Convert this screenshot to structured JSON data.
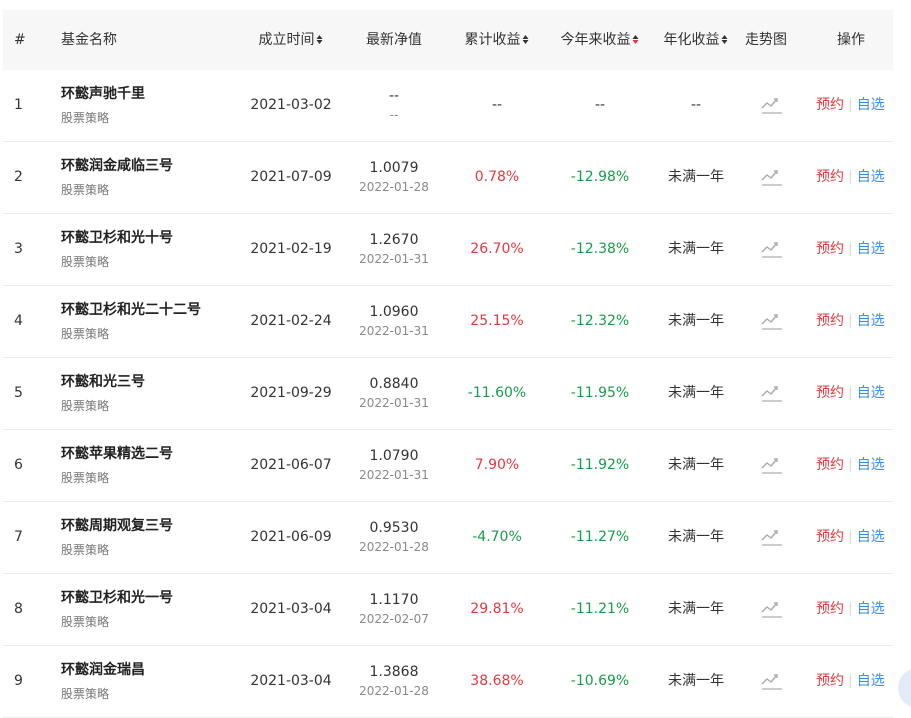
{
  "headers": {
    "index": "#",
    "name": "基金名称",
    "established": "成立时间",
    "nav": "最新净值",
    "cumulative": "累计收益",
    "ytd": "今年来收益",
    "annualized": "年化收益",
    "trend": "走势图",
    "actions": "操作"
  },
  "colors": {
    "positive": "#e0393e",
    "negative": "#1a9a4a",
    "link": "#3a8ee6",
    "header_bg": "#f7f7f7"
  },
  "action_labels": {
    "reserve": "预约",
    "watch": "自选"
  },
  "rows": [
    {
      "index": "1",
      "name": "环懿声驰千里",
      "category": "股票策略",
      "established": "2021-03-02",
      "nav": "--",
      "nav_date": "--",
      "cumulative": "--",
      "ytd": "--",
      "annualized": "--"
    },
    {
      "index": "2",
      "name": "环懿润金咸临三号",
      "category": "股票策略",
      "established": "2021-07-09",
      "nav": "1.0079",
      "nav_date": "2022-01-28",
      "cumulative": "0.78%",
      "ytd": "-12.98%",
      "annualized": "未满一年"
    },
    {
      "index": "3",
      "name": "环懿卫杉和光十号",
      "category": "股票策略",
      "established": "2021-02-19",
      "nav": "1.2670",
      "nav_date": "2022-01-31",
      "cumulative": "26.70%",
      "ytd": "-12.38%",
      "annualized": "未满一年"
    },
    {
      "index": "4",
      "name": "环懿卫杉和光二十二号",
      "category": "股票策略",
      "established": "2021-02-24",
      "nav": "1.0960",
      "nav_date": "2022-01-31",
      "cumulative": "25.15%",
      "ytd": "-12.32%",
      "annualized": "未满一年"
    },
    {
      "index": "5",
      "name": "环懿和光三号",
      "category": "股票策略",
      "established": "2021-09-29",
      "nav": "0.8840",
      "nav_date": "2022-01-31",
      "cumulative": "-11.60%",
      "ytd": "-11.95%",
      "annualized": "未满一年"
    },
    {
      "index": "6",
      "name": "环懿苹果精选二号",
      "category": "股票策略",
      "established": "2021-06-07",
      "nav": "1.0790",
      "nav_date": "2022-01-31",
      "cumulative": "7.90%",
      "ytd": "-11.92%",
      "annualized": "未满一年"
    },
    {
      "index": "7",
      "name": "环懿周期观复三号",
      "category": "股票策略",
      "established": "2021-06-09",
      "nav": "0.9530",
      "nav_date": "2022-01-28",
      "cumulative": "-4.70%",
      "ytd": "-11.27%",
      "annualized": "未满一年"
    },
    {
      "index": "8",
      "name": "环懿卫杉和光一号",
      "category": "股票策略",
      "established": "2021-03-04",
      "nav": "1.1170",
      "nav_date": "2022-02-07",
      "cumulative": "29.81%",
      "ytd": "-11.21%",
      "annualized": "未满一年"
    },
    {
      "index": "9",
      "name": "环懿润金瑞昌",
      "category": "股票策略",
      "established": "2021-03-04",
      "nav": "1.3868",
      "nav_date": "2022-01-28",
      "cumulative": "38.68%",
      "ytd": "-10.69%",
      "annualized": "未满一年"
    }
  ]
}
